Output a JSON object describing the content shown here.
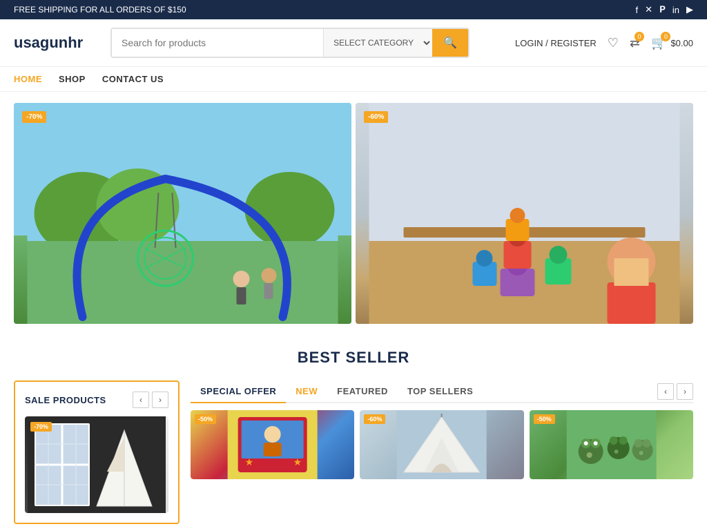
{
  "topbar": {
    "shipping_text": "FREE SHIPPING FOR ALL ORDERS OF $150",
    "social_icons": [
      "facebook",
      "twitter",
      "pinterest",
      "linkedin",
      "telegram"
    ]
  },
  "header": {
    "logo": "usagunhr",
    "search_placeholder": "Search for products",
    "category_label": "SELECT CATEGORY",
    "search_icon": "🔍",
    "login_label": "LOGIN / REGISTER",
    "wishlist_icon": "♡",
    "compare_badge": "0",
    "cart_badge": "0",
    "cart_amount": "$0.00"
  },
  "nav": {
    "items": [
      {
        "label": "HOME",
        "active": true
      },
      {
        "label": "SHOP",
        "active": false
      },
      {
        "label": "CONTACT US",
        "active": false
      }
    ]
  },
  "hero": {
    "left_badge": "-70%",
    "right_badge": "-60%"
  },
  "best_seller": {
    "title": "BEST SELLER"
  },
  "sale_products": {
    "title": "SALE PRODUCTS",
    "badge": "-70%"
  },
  "special_offer": {
    "label": "SPECIAL OFFER",
    "tabs": [
      {
        "label": "NEW",
        "active": false,
        "highlight": true
      },
      {
        "label": "FEATURED",
        "active": false
      },
      {
        "label": "TOP SELLERS",
        "active": false
      }
    ],
    "products": [
      {
        "badge": "-50%"
      },
      {
        "badge": "-60%"
      },
      {
        "badge": "-50%"
      }
    ]
  }
}
